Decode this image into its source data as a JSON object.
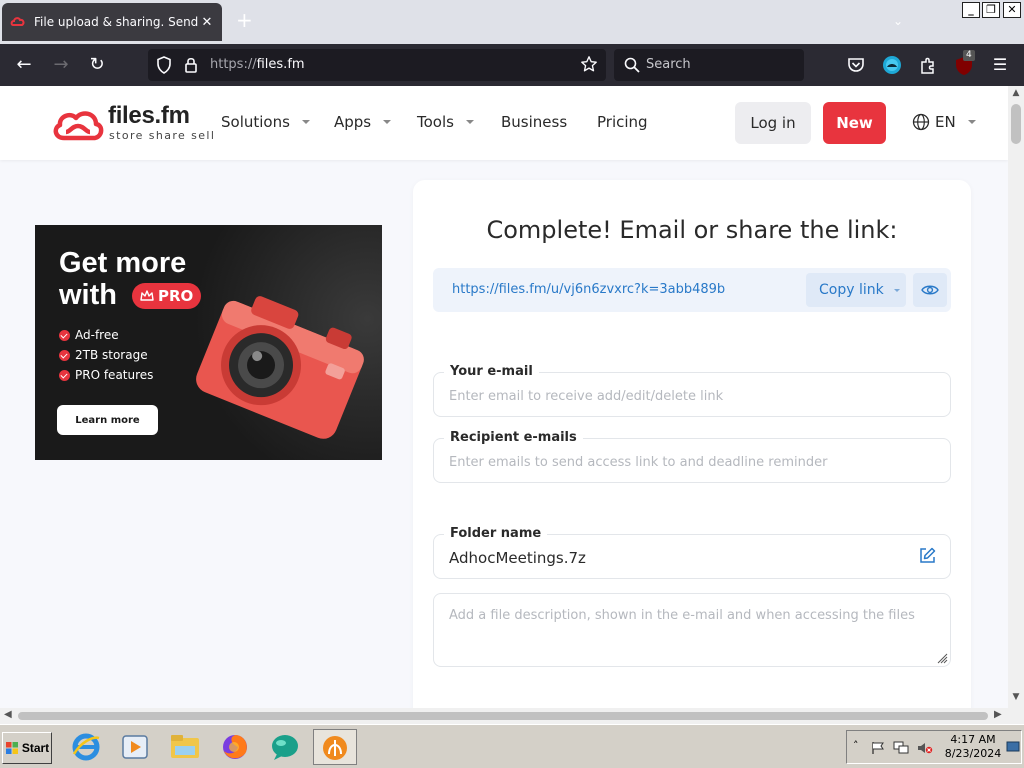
{
  "browser": {
    "tab_title": "File upload & sharing. Send lar",
    "url_protocol": "https://",
    "url_host": "files.fm",
    "search_placeholder": "Search",
    "extension_badge": "4"
  },
  "site": {
    "logo_name": "files.fm",
    "logo_tagline": "store  share  sell",
    "nav": [
      {
        "label": "Solutions",
        "dropdown": true
      },
      {
        "label": "Apps",
        "dropdown": true
      },
      {
        "label": "Tools",
        "dropdown": true
      },
      {
        "label": "Business",
        "dropdown": false
      },
      {
        "label": "Pricing",
        "dropdown": false
      }
    ],
    "login_label": "Log in",
    "new_label": "New",
    "language": "EN",
    "brand_color": "#e8343e"
  },
  "ad": {
    "headline_line1": "Get more",
    "headline_line2": "with",
    "badge": "PRO",
    "features": [
      "Ad-free",
      "2TB storage",
      "PRO features"
    ],
    "cta": "Learn more"
  },
  "share": {
    "title": "Complete! Email or share the link:",
    "link": "https://files.fm/u/vj6n6zvxrc?k=3abb489b",
    "copy_label": "Copy link",
    "your_email_label": "Your e-mail",
    "your_email_placeholder": "Enter email to receive add/edit/delete link",
    "recipient_label": "Recipient e-mails",
    "recipient_placeholder": "Enter emails to send access link to and deadline reminder",
    "folder_label": "Folder name",
    "folder_value": "AdhocMeetings.7z",
    "description_placeholder": "Add a file description, shown in the e-mail and when accessing the files"
  },
  "taskbar": {
    "start_label": "Start",
    "time": "4:17 AM",
    "date": "8/23/2024"
  }
}
